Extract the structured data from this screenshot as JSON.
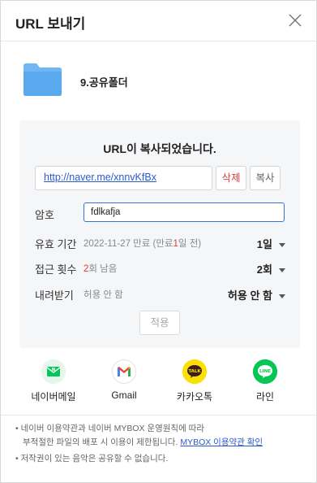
{
  "header": {
    "title": "URL 보내기"
  },
  "folder": {
    "name": "9.공유폴더"
  },
  "panel": {
    "title": "URL이 복사되었습니다.",
    "url": "http://naver.me/xnnvKfBx",
    "delete_label": "삭제",
    "copy_label": "복사",
    "password": {
      "label": "암호",
      "value": "fdlkafja"
    },
    "expiry": {
      "label": "유효 기간",
      "sub_prefix": "2022-11-27 만료 (만료",
      "sub_red": "1",
      "sub_suffix": "일 전)",
      "value": "1일"
    },
    "access": {
      "label": "접근 횟수",
      "sub_red": "2",
      "sub_suffix": "회 남음",
      "value": "2회"
    },
    "download": {
      "label": "내려받기",
      "sub": "허용 안 함",
      "value": "허용 안 함"
    },
    "apply_label": "적용"
  },
  "share": [
    {
      "label": "네이버메일",
      "icon": "naver-mail-icon",
      "color": "#03c75a"
    },
    {
      "label": "Gmail",
      "icon": "gmail-icon",
      "color": "#ffffff"
    },
    {
      "label": "카카오톡",
      "icon": "kakaotalk-icon",
      "color": "#fae100"
    },
    {
      "label": "라인",
      "icon": "line-icon",
      "color": "#06c755"
    }
  ],
  "notices": {
    "line1": "• 네이버 이용약관과 네이버 MYBOX 운영원칙에 따라",
    "line2_text": "부적절한 파일의 배포 시 이용이 제한됩니다.",
    "line2_link": "MYBOX 이용약관 확인",
    "line3": "• 저작권이 있는 음악은 공유할 수 없습니다."
  }
}
